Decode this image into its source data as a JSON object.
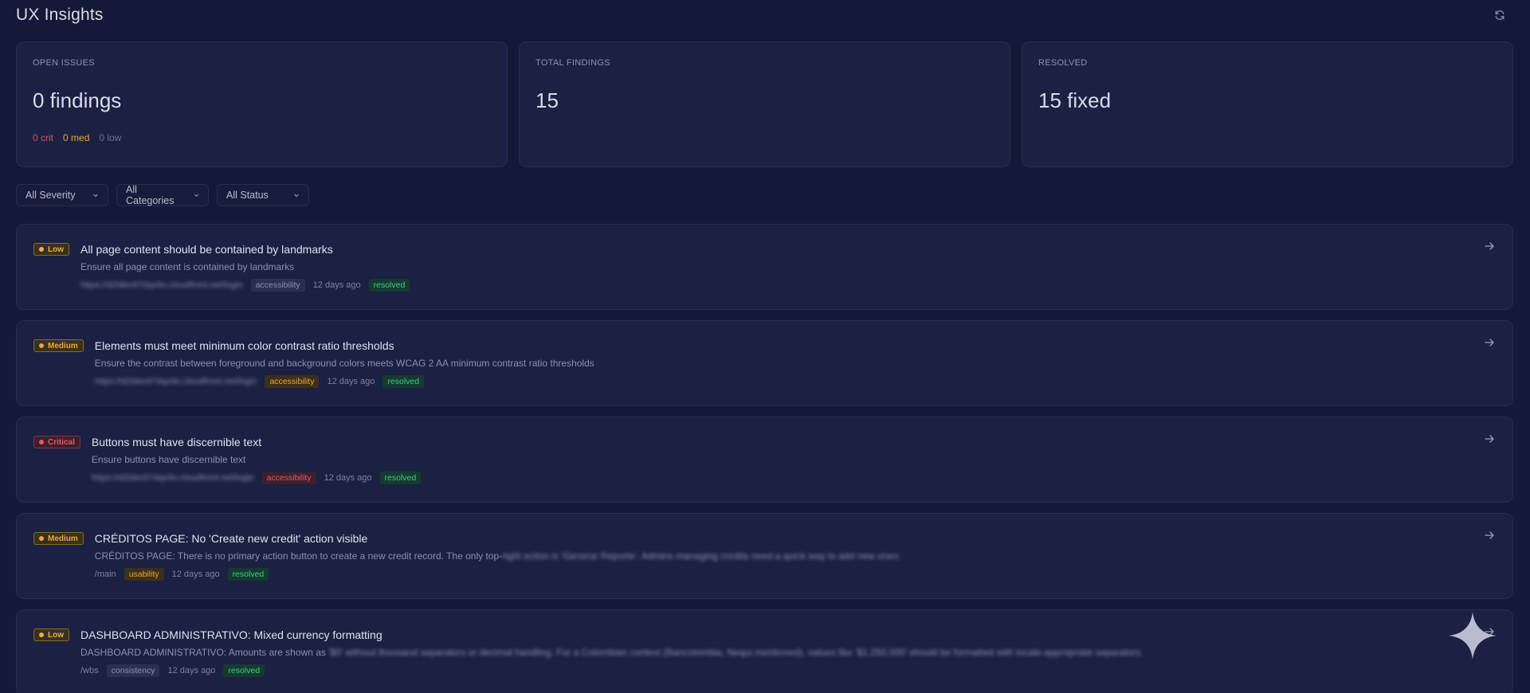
{
  "header": {
    "title": "UX Insights",
    "refresh_icon": "refresh-icon"
  },
  "stats": {
    "open": {
      "label": "OPEN ISSUES",
      "value": "0 findings",
      "crit": "0 crit",
      "med": "0 med",
      "low": "0 low"
    },
    "total": {
      "label": "TOTAL FINDINGS",
      "value": "15"
    },
    "resolved": {
      "label": "RESOLVED",
      "value": "15 fixed"
    }
  },
  "filters": {
    "severity": "All Severity",
    "categories": "All Categories",
    "status": "All Status"
  },
  "findings": [
    {
      "severity": "Low",
      "title": "All page content should be contained by landmarks",
      "desc": "Ensure all page content is contained by landmarks",
      "url": "https://d2ldev97dqx9o.cloudfront.net/login",
      "category": "accessibility",
      "time": "12 days ago",
      "status": "resolved"
    },
    {
      "severity": "Medium",
      "title": "Elements must meet minimum color contrast ratio thresholds",
      "desc": "Ensure the contrast between foreground and background colors meets WCAG 2 AA minimum contrast ratio thresholds",
      "url": "https://d2ldev97dqx9o.cloudfront.net/login",
      "category": "accessibility",
      "time": "12 days ago",
      "status": "resolved"
    },
    {
      "severity": "Critical",
      "title": "Buttons must have discernible text",
      "desc": "Ensure buttons have discernible text",
      "url": "https://d2ldev97dqx9o.cloudfront.net/login",
      "category": "accessibility",
      "time": "12 days ago",
      "status": "resolved"
    },
    {
      "severity": "Medium",
      "title": "CRÉDITOS PAGE: No 'Create new credit' action visible",
      "desc_clear": "CRÉDITOS PAGE: There is no primary action button to create a new credit record. The only top-",
      "desc_blur": "right action is 'Generar Reporte'. Admins managing credits need a quick way to add new ones.",
      "url": "/main",
      "category": "usability",
      "time": "12 days ago",
      "status": "resolved"
    },
    {
      "severity": "Low",
      "title": "DASHBOARD ADMINISTRATIVO: Mixed currency formatting",
      "desc_clear": "DASHBOARD ADMINISTRATIVO: Amounts are shown as ",
      "desc_blur": "'$0' without thousand separators or decimal handling. For a Colombian context (Bancolombia, Nequi mentioned), values like '$1.250.000' should be formatted with locale-appropriate separators.",
      "url": "/wbs",
      "category": "consistency",
      "time": "12 days ago",
      "status": "resolved"
    }
  ],
  "colors": {
    "background": "#131936",
    "card": "#1a2142",
    "critical": "#e04a5e",
    "medium": "#e8a838",
    "resolved": "#3dcc80"
  }
}
